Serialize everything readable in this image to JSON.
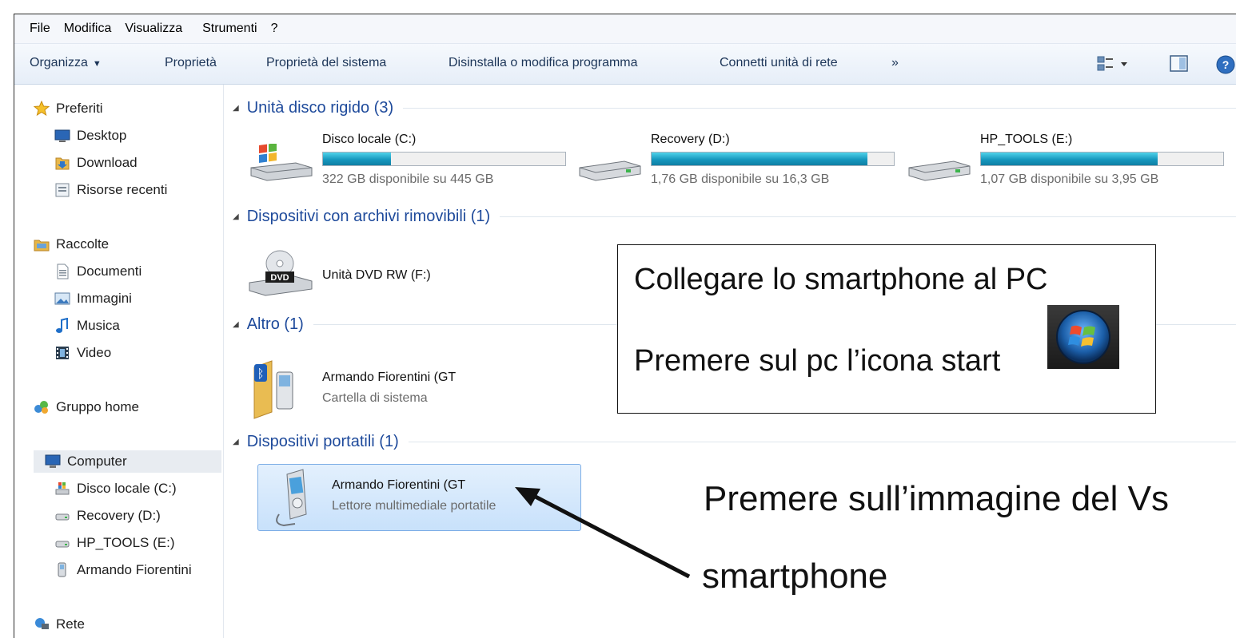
{
  "menu": {
    "items": [
      "File",
      "Modifica",
      "Visualizza",
      "Strumenti",
      "?"
    ]
  },
  "toolbar": {
    "organize": "Organizza",
    "properties": "Proprietà",
    "system_properties": "Proprietà del sistema",
    "uninstall": "Disinstalla o modifica programma",
    "map_drive": "Connetti unità di rete",
    "more": "»"
  },
  "nav": {
    "favorites": "Preferiti",
    "desktop": "Desktop",
    "download": "Download",
    "recent": "Risorse recenti",
    "libraries": "Raccolte",
    "documents": "Documenti",
    "pictures": "Immagini",
    "music": "Musica",
    "video": "Video",
    "homegroup": "Gruppo home",
    "computer": "Computer",
    "drive_c": "Disco locale (C:)",
    "drive_d": "Recovery (D:)",
    "drive_e": "HP_TOOLS (E:)",
    "phone": "Armando Fiorentini",
    "network": "Rete"
  },
  "groups": {
    "hard_disks": "Unità disco rigido (3)",
    "removable": "Dispositivi con archivi rimovibili (1)",
    "other": "Altro (1)",
    "portable": "Dispositivi portatili (1)"
  },
  "drives": [
    {
      "name": "Disco locale (C:)",
      "info": "322 GB disponibile su 445 GB",
      "used_fraction": 0.28
    },
    {
      "name": "Recovery (D:)",
      "info": "1,76 GB disponibile su 16,3 GB",
      "used_fraction": 0.89
    },
    {
      "name": "HP_TOOLS (E:)",
      "info": "1,07 GB disponibile su 3,95 GB",
      "used_fraction": 0.73
    }
  ],
  "dvd": {
    "name": "Unità DVD RW (F:)",
    "icon_label": "DVD"
  },
  "other_item": {
    "name": "Armando Fiorentini (GT",
    "subtitle": "Cartella di sistema"
  },
  "portable_item": {
    "name": "Armando Fiorentini (GT",
    "subtitle": "Lettore multimediale portatile"
  },
  "annotations": {
    "box_line1": "Collegare lo smartphone al PC",
    "box_line2": "Premere sul pc l’icona start",
    "caption_line1": "Premere sull’immagine del Vs",
    "caption_line2": "smartphone"
  },
  "colors": {
    "group_title": "#1e4a9b",
    "drive_bar": "#1697be",
    "selection": "#c8e1fb"
  }
}
